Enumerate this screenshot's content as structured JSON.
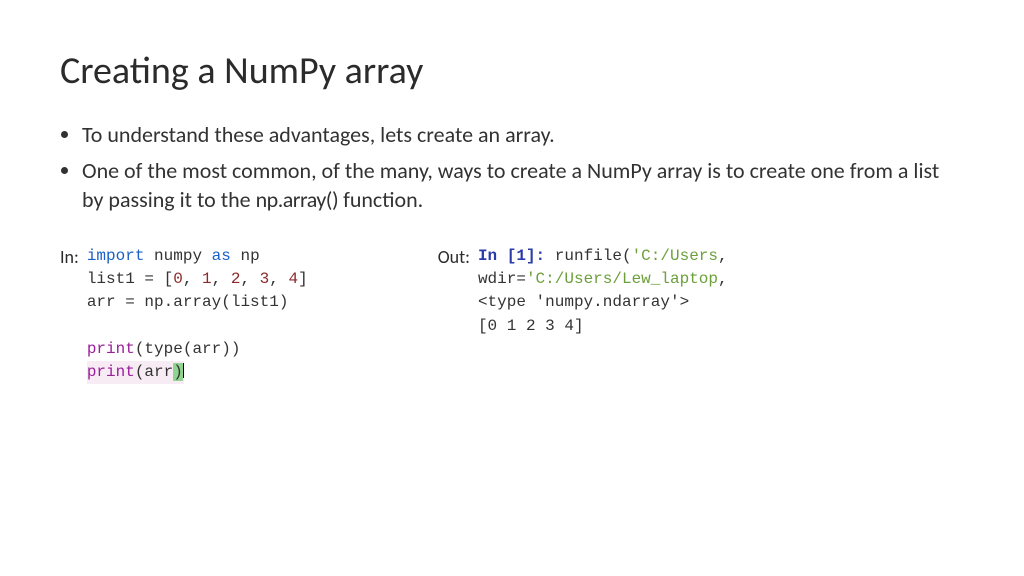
{
  "title": "Creating a NumPy array",
  "bullets": {
    "b1": "To understand these advantages, lets create an array.",
    "b2a": "One of the most common, of the many, ways to create a NumPy array is to create one from a list by passing it to the ",
    "b2_code": "np.array()",
    "b2b": " function."
  },
  "labels": {
    "in": "In:",
    "out": "Out:"
  },
  "code_in": {
    "kw_import": "import",
    "mod_numpy": "numpy",
    "kw_as": "as",
    "alias": "np",
    "l2_a": "list1 = [",
    "n0": "0",
    "c1": ", ",
    "n1": "1",
    "c2": ", ",
    "n2": "2",
    "c3": ", ",
    "n3": "3",
    "c4": ", ",
    "n4": "4",
    "l2_b": "]",
    "l3": "arr = np.array(list1)",
    "blank": "",
    "fn_print1": "print",
    "l5_rest": "(type(arr))",
    "fn_print2": "print",
    "l6_open": "(arr",
    "l6_close": ")"
  },
  "code_out": {
    "prompt": "In [1]:",
    "l1_rest": " runfile(",
    "l1_str": "'C:/Users",
    "l1_tail": ",",
    "l2_a": "wdir=",
    "l2_str": "'C:/Users/Lew_laptop",
    "l2_tail": ",",
    "l3": "<type 'numpy.ndarray'>",
    "l4": "[0 1 2 3 4]"
  }
}
